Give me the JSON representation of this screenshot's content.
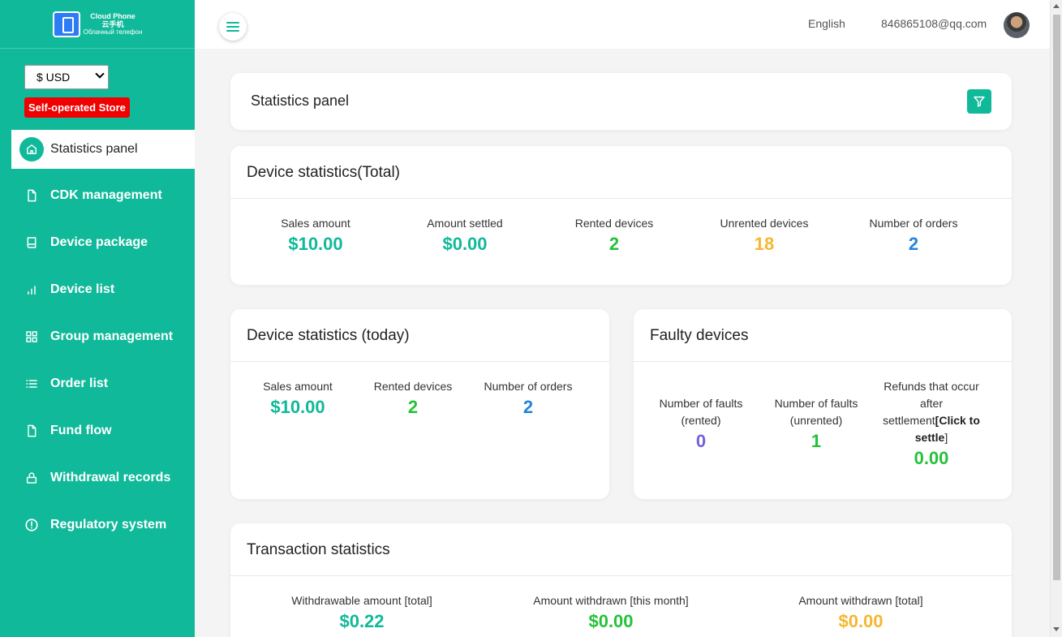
{
  "logo": {
    "line1": "Cloud Phone",
    "line2": "云手机",
    "line3": "Облачный телефон"
  },
  "sidebar": {
    "currency": "$ USD",
    "store_badge": "Self-operated Store",
    "items": [
      {
        "label": "Statistics panel",
        "icon": "home-icon",
        "active": true
      },
      {
        "label": "CDK management",
        "icon": "document-icon"
      },
      {
        "label": "Device package",
        "icon": "book-icon"
      },
      {
        "label": "Device list",
        "icon": "bar-chart-icon"
      },
      {
        "label": "Group management",
        "icon": "grid-icon"
      },
      {
        "label": "Order list",
        "icon": "list-icon"
      },
      {
        "label": "Fund flow",
        "icon": "document-icon"
      },
      {
        "label": "Withdrawal records",
        "icon": "lock-icon"
      },
      {
        "label": "Regulatory system",
        "icon": "alert-circle-icon"
      }
    ]
  },
  "header": {
    "language": "English",
    "email": "846865108@qq.com"
  },
  "panel_title": "Statistics panel",
  "total": {
    "title": "Device statistics(Total)",
    "stats": [
      {
        "label": "Sales amount",
        "value": "$10.00"
      },
      {
        "label": "Amount settled",
        "value": "$0.00"
      },
      {
        "label": "Rented devices",
        "value": "2"
      },
      {
        "label": "Unrented devices",
        "value": "18"
      },
      {
        "label": "Number of orders",
        "value": "2"
      }
    ]
  },
  "today": {
    "title": "Device statistics (today)",
    "stats": [
      {
        "label": "Sales amount",
        "value": "$10.00"
      },
      {
        "label": "Rented devices",
        "value": "2"
      },
      {
        "label": "Number of orders",
        "value": "2"
      }
    ]
  },
  "faulty": {
    "title": "Faulty devices",
    "stats": [
      {
        "label1": "Number of faults",
        "label2": "(rented)",
        "value": "0"
      },
      {
        "label1": "Number of faults",
        "label2": "(unrented)",
        "value": "1"
      },
      {
        "label1": "Refunds that occur",
        "label2": "after",
        "label3": "settlement",
        "link": "[Click to",
        "link2": "settle",
        "end": "]",
        "value": "0.00"
      }
    ]
  },
  "transaction": {
    "title": "Transaction statistics",
    "stats": [
      {
        "label": "Withdrawable amount [total]",
        "value": "$0.22"
      },
      {
        "label": "Amount withdrawn [this month]",
        "value": "$0.00"
      },
      {
        "label": "Amount withdrawn [total]",
        "value": "$0.00"
      }
    ]
  },
  "colors": {
    "accent": "#10b99a",
    "green": "#24c23a",
    "orange": "#f5b731",
    "blue": "#2184de",
    "purple": "#7460d8",
    "badge_red": "#f00000"
  }
}
